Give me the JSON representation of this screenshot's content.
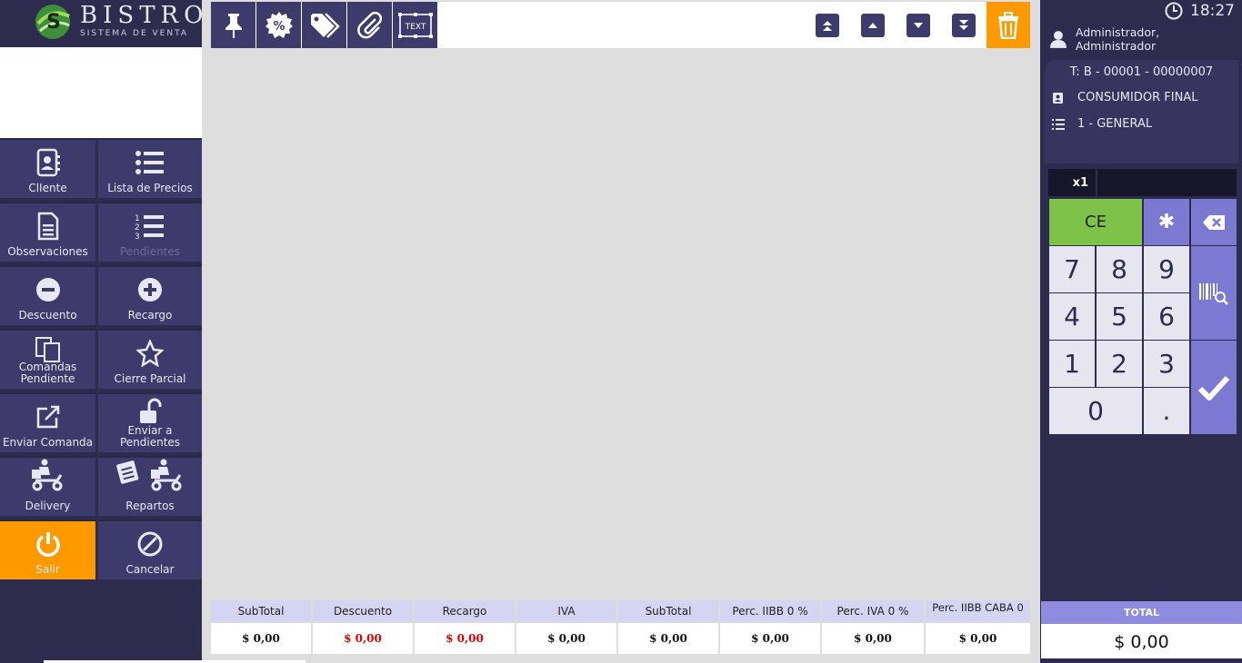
{
  "logo": {
    "brand": "BISTROT",
    "tagline": "SISTEMA DE VENTA"
  },
  "left_menu": [
    {
      "label": "ClIente"
    },
    {
      "label": "Lista de Precios"
    },
    {
      "label": "Observaciones"
    },
    {
      "label": "Pendientes",
      "disabled": true
    },
    {
      "label": "Descuento"
    },
    {
      "label": "Recargo"
    },
    {
      "label": "Comandas Pendiente"
    },
    {
      "label": "Cierre Parcial"
    },
    {
      "label": "Enviar Comanda"
    },
    {
      "label": "Enviar a Pendientes"
    },
    {
      "label": "Delivery"
    },
    {
      "label": "Repartos"
    },
    {
      "label": "Salir"
    },
    {
      "label": "Cancelar"
    }
  ],
  "toolbar": {
    "tools": [
      "pin-icon",
      "discount-badge-icon",
      "tags-icon",
      "paperclip-icon",
      "text-icon"
    ],
    "text_icon_label": "TEXT",
    "nav": [
      "first-icon",
      "up-icon",
      "down-icon",
      "last-icon"
    ],
    "delete": "trash-icon"
  },
  "totals": {
    "headers": [
      "SubTotal",
      "Descuento",
      "Recargo",
      "IVA",
      "SubTotal",
      "Perc. IIBB 0 %",
      "Perc. IVA 0 %",
      "Perc. IIBB CABA 0"
    ],
    "values": [
      "$ 0,00",
      "$ 0,00",
      "$ 0,00",
      "$ 0,00",
      "$ 0,00",
      "$ 0,00",
      "$ 0,00",
      "$ 0,00"
    ]
  },
  "header_right": {
    "time": "18:27",
    "user": "Administrador, Administrador"
  },
  "ticket": {
    "number": "T: B - 00001 - 00000007",
    "customer": "CONSUMIDOR FINAL",
    "price_list": "1 - GENERAL"
  },
  "keypad": {
    "multiplier": "x1",
    "clear": "CE",
    "star": "✱",
    "digits": [
      "7",
      "8",
      "9",
      "4",
      "5",
      "6",
      "1",
      "2",
      "3",
      "0",
      "."
    ]
  },
  "total": {
    "label": "TOTAL",
    "value": "$ 0,00"
  },
  "colors": {
    "navy": "#2d2b4e",
    "button": "#3d3a6c",
    "orange": "#ff9900",
    "green": "#7fc24a",
    "violet": "#7b79d1",
    "red": "#e00000"
  }
}
